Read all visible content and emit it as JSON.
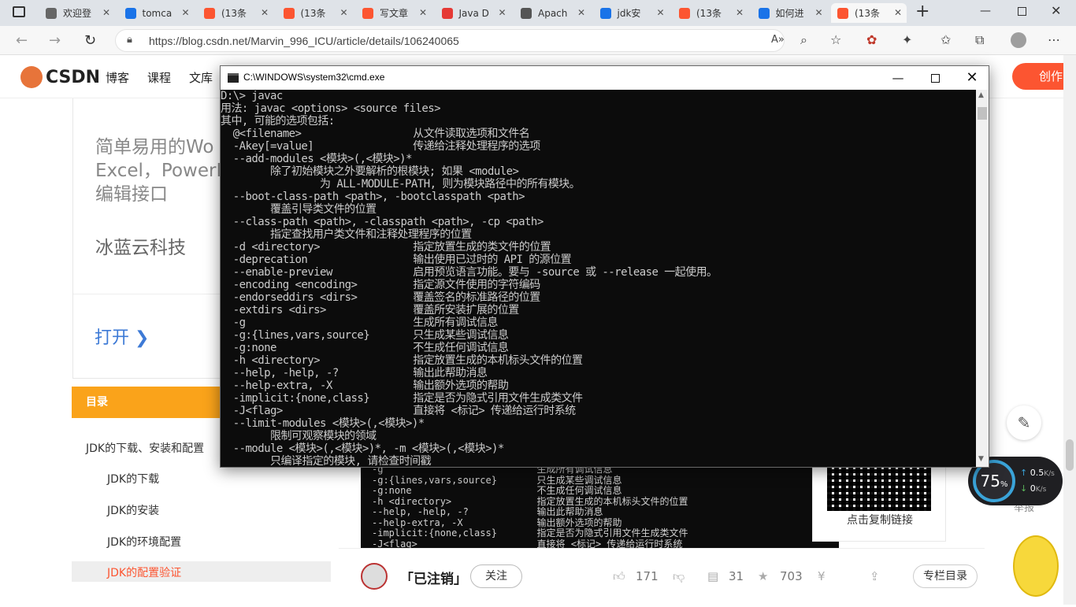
{
  "browser": {
    "tabs": [
      {
        "label": "欢迎登",
        "color": "#666666"
      },
      {
        "label": "tomca",
        "color": "#1a73e8"
      },
      {
        "label": "(13条",
        "color": "#fc5531"
      },
      {
        "label": "(13条",
        "color": "#fc5531"
      },
      {
        "label": "写文章",
        "color": "#fc5531"
      },
      {
        "label": "Java D",
        "color": "#e53935"
      },
      {
        "label": "Apach",
        "color": "#555555"
      },
      {
        "label": "jdk安",
        "color": "#1a73e8"
      },
      {
        "label": "(13条",
        "color": "#fc5531"
      },
      {
        "label": "如何进",
        "color": "#1a73e8"
      },
      {
        "label": "(13条",
        "color": "#fc5531"
      }
    ],
    "url": "https://blog.csdn.net/Marvin_996_ICU/article/details/106240065"
  },
  "csdn": {
    "logo": "CSDN",
    "nav": [
      "博客",
      "课程",
      "文库"
    ],
    "create_label": "创作",
    "left_card": {
      "line1": "简单易用的Wo",
      "line2": "Excel，PowerP",
      "line3": "编辑接口",
      "company": "冰蓝云科技",
      "open_label": "打开 ❯"
    },
    "toc": {
      "title": "目录",
      "items": [
        "JDK的下载、安装和配置",
        "JDK的下载",
        "JDK的安装",
        "JDK的环境配置",
        "JDK的配置验证"
      ]
    },
    "qr_label": "点击复制链接",
    "bottom": {
      "author": "「已注销」",
      "follow": "关注",
      "likes": "171",
      "comments": "31",
      "favorites": "703",
      "column_toc": "专栏目录"
    },
    "report_label": "举报",
    "speed": {
      "percent": "75",
      "up": "0.5",
      "down": "0",
      "unit": "K/s"
    }
  },
  "cmd": {
    "title": "C:\\WINDOWS\\system32\\cmd.exe",
    "lines": [
      "D:\\> javac",
      "用法: javac <options> <source files>",
      "其中, 可能的选项包括:",
      "  @<filename>                  从文件读取选项和文件名",
      "  -Akey[=value]                传递给注释处理程序的选项",
      "  --add-modules <模块>(,<模块>)*",
      "        除了初始模块之外要解析的根模块; 如果 <module>",
      "                为 ALL-MODULE-PATH, 则为模块路径中的所有模块。",
      "  --boot-class-path <path>, -bootclasspath <path>",
      "        覆盖引导类文件的位置",
      "  --class-path <path>, -classpath <path>, -cp <path>",
      "        指定查找用户类文件和注释处理程序的位置",
      "  -d <directory>               指定放置生成的类文件的位置",
      "  -deprecation                 输出使用已过时的 API 的源位置",
      "  --enable-preview             启用预览语言功能。要与 -source 或 --release 一起使用。",
      "  -encoding <encoding>         指定源文件使用的字符编码",
      "  -endorseddirs <dirs>         覆盖签名的标准路径的位置",
      "  -extdirs <dirs>              覆盖所安装扩展的位置",
      "  -g                           生成所有调试信息",
      "  -g:{lines,vars,source}       只生成某些调试信息",
      "  -g:none                      不生成任何调试信息",
      "  -h <directory>               指定放置生成的本机标头文件的位置",
      "  --help, -help, -?            输出此帮助消息",
      "  --help-extra, -X             输出额外选项的帮助",
      "  -implicit:{none,class}       指定是否为隐式引用文件生成类文件",
      "  -J<flag>                     直接将 <标记> 传递给运行时系统",
      "  --limit-modules <模块>(,<模块>)*",
      "        限制可观察模块的领域",
      "  --module <模块>(,<模块>)*, -m <模块>(,<模块>)*",
      "        只编译指定的模块, 请检查时间戳"
    ]
  },
  "article_image_lines": [
    "-g                           生成所有调试信息",
    "-g:{lines,vars,source}       只生成某些调试信息",
    "-g:none                      不生成任何调试信息",
    "-h <directory>               指定放置生成的本机标头文件的位置",
    "--help, -help, -?            输出此帮助消息",
    "--help-extra, -X             输出额外选项的帮助",
    "-implicit:{none,class}       指定是否为隐式引用文件生成类文件",
    "-J<flag>                     直接将 <标记> 传递给运行时系统"
  ]
}
